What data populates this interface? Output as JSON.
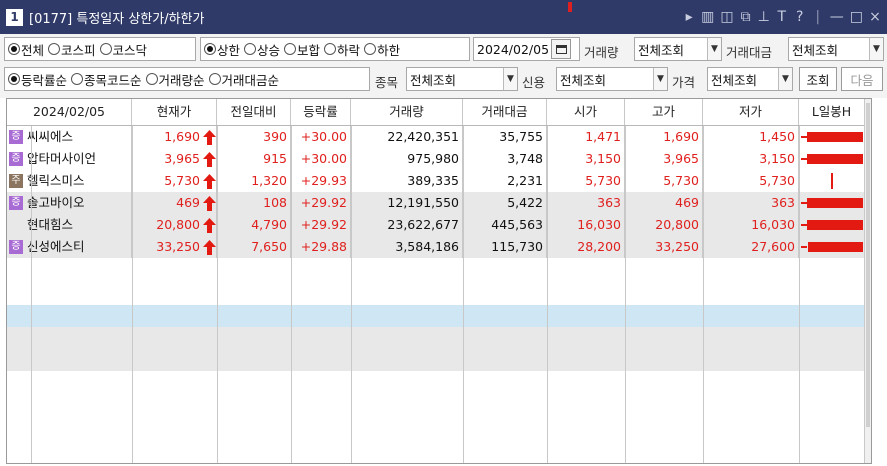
{
  "window": {
    "number": "1",
    "title": "[0177] 특정일자 상한가/하한가",
    "tools": [
      "▸",
      "▥",
      "◫",
      "⧉",
      "⊥",
      "T",
      "?",
      "|",
      "—",
      "□",
      "×"
    ]
  },
  "filters": {
    "market_options": [
      "전체",
      "코스피",
      "코스닥"
    ],
    "market_selected": 0,
    "limit_options": [
      "상한",
      "상승",
      "보합",
      "하락",
      "하한"
    ],
    "limit_selected": 0,
    "date": "2024/02/05",
    "volume_label": "거래량",
    "volume_value": "전체조회",
    "amount_label": "거래대금",
    "amount_value": "전체조회",
    "sort_options": [
      "등락률순",
      "종목코드순",
      "거래량순",
      "거래대금순"
    ],
    "sort_selected": 0,
    "stock_label": "종목",
    "stock_value": "전체조회",
    "credit_label": "신용",
    "credit_value": "전체조회",
    "price_label": "가격",
    "price_value": "전체조회",
    "search_button": "조회",
    "next_button": "다음"
  },
  "table": {
    "columns": [
      "2024/02/05",
      "현재가",
      "전일대비",
      "등락률",
      "거래량",
      "거래대금",
      "시가",
      "고가",
      "저가",
      "L일봉H"
    ],
    "rows": [
      {
        "badge": "증",
        "name": "씨씨에스",
        "price": "1,690",
        "change": "390",
        "rate": "+30.00",
        "volume": "22,420,351",
        "amount": "35,755",
        "open": "1,471",
        "high": "1,690",
        "low": "1,450",
        "open_color": "red",
        "high_color": "red",
        "low_color": "red",
        "candle": 0.96
      },
      {
        "badge": "증",
        "name": "압타머사이언",
        "price": "3,965",
        "change": "915",
        "rate": "+30.00",
        "volume": "975,980",
        "amount": "3,748",
        "open": "3,150",
        "high": "3,965",
        "low": "3,150",
        "open_color": "red",
        "high_color": "red",
        "low_color": "red",
        "candle": 0.96
      },
      {
        "badge": "주",
        "name": "헬릭스미스",
        "price": "5,730",
        "change": "1,320",
        "rate": "+29.93",
        "volume": "389,335",
        "amount": "2,231",
        "open": "5,730",
        "high": "5,730",
        "low": "5,730",
        "open_color": "red",
        "high_color": "red",
        "low_color": "red",
        "candle": 0.0
      },
      {
        "badge": "증",
        "name": "솔고바이오",
        "price": "469",
        "change": "108",
        "rate": "+29.92",
        "volume": "12,191,550",
        "amount": "5,422",
        "open": "363",
        "high": "469",
        "low": "363",
        "open_color": "red",
        "high_color": "red",
        "low_color": "red",
        "candle": 0.96
      },
      {
        "badge": "",
        "name": "현대힘스",
        "price": "20,800",
        "change": "4,790",
        "rate": "+29.92",
        "volume": "23,622,677",
        "amount": "445,563",
        "open": "16,030",
        "high": "20,800",
        "low": "16,030",
        "open_color": "red",
        "high_color": "red",
        "low_color": "red",
        "candle": 0.96
      },
      {
        "badge": "증",
        "name": "신성에스티",
        "price": "33,250",
        "change": "7,650",
        "rate": "+29.88",
        "volume": "3,584,186",
        "amount": "115,730",
        "open": "28,200",
        "high": "33,250",
        "low": "27,600",
        "open_color": "red",
        "high_color": "red",
        "low_color": "red",
        "candle": 0.94
      }
    ]
  },
  "colors": {
    "titlebar": "#2f3a68",
    "up_red": "#e0201e",
    "candle_red": "#e21a12",
    "row_alt": "#e8e8e8",
    "selected_row": "#cfe6f5",
    "badge_jeung": "#a86bd4",
    "badge_ju": "#8b7560"
  }
}
